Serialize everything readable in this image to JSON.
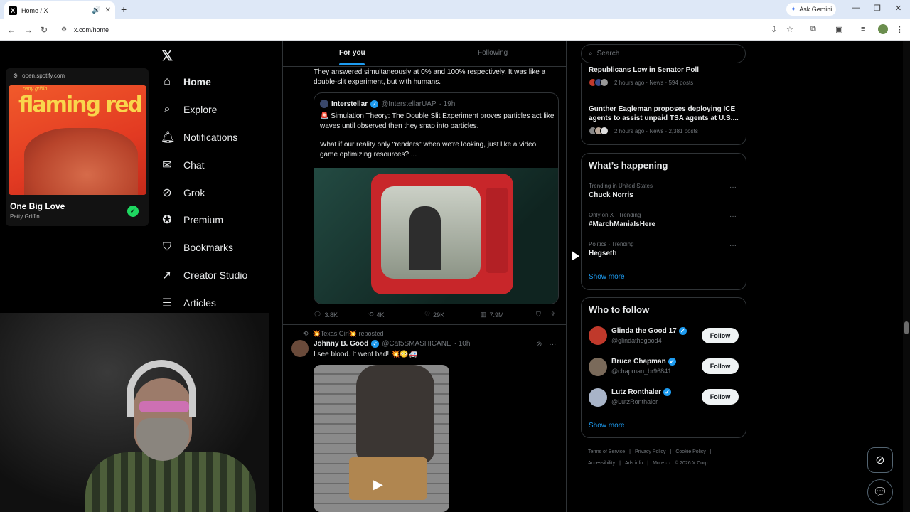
{
  "browser": {
    "tab_title": "Home / X",
    "tab_favicon": "X",
    "url": "x.com/home",
    "gemini_label": "Ask Gemini"
  },
  "spotify": {
    "url": "open.spotify.com",
    "album_small": "patty griffin",
    "album_title": "flaming red",
    "song": "One Big Love",
    "artist": "Patty Griffin"
  },
  "nav": {
    "items": [
      {
        "label": "Home",
        "icon": "home-icon"
      },
      {
        "label": "Explore",
        "icon": "search-icon"
      },
      {
        "label": "Notifications",
        "icon": "bell-icon"
      },
      {
        "label": "Chat",
        "icon": "mail-icon"
      },
      {
        "label": "Grok",
        "icon": "grok-icon"
      },
      {
        "label": "Premium",
        "icon": "premium-icon"
      },
      {
        "label": "Bookmarks",
        "icon": "bookmark-icon"
      },
      {
        "label": "Creator Studio",
        "icon": "rocket-icon"
      },
      {
        "label": "Articles",
        "icon": "article-icon"
      }
    ]
  },
  "feed": {
    "tabs": [
      "For you",
      "Following"
    ],
    "post1": {
      "text": "They answered simultaneously at 0% and 100% respectively. It was like a double-slit experiment, but with humans.",
      "quote": {
        "name": "Interstellar",
        "handle": "@InterstellarUAP",
        "time": "· 19h",
        "line1": "🚨 Simulation Theory: The Double Slit Experiment proves particles act like waves until observed then they snap into particles.",
        "line2": "What if our reality only \"renders\" when we're looking, just like a video game optimizing resources? ..."
      },
      "replies": "3.8K",
      "reposts": "4K",
      "likes": "29K",
      "views": "7.9M"
    },
    "post2": {
      "reposted_by": "💥Texas Girl💥 reposted",
      "name": "Johnny B. Good",
      "handle": "@Cat5SMASHICANE",
      "time": "· 10h",
      "text": "I see blood. It went bad! 💥😳🚑"
    }
  },
  "sidebar": {
    "search_placeholder": "Search",
    "news": [
      {
        "title": "Republicans Low in Senator Poll",
        "meta": "2 hours ago · News · 594 posts"
      },
      {
        "title": "Gunther Eagleman proposes deploying ICE agents to assist unpaid TSA agents at U.S....",
        "meta": "2 hours ago · News · 2,381 posts"
      }
    ],
    "happening_title": "What’s happening",
    "trends": [
      {
        "context": "Trending in United States",
        "name": "Chuck Norris"
      },
      {
        "context": "Only on X · Trending",
        "name": "#MarchManiaIsHere"
      },
      {
        "context": "Politics · Trending",
        "name": "Hegseth"
      }
    ],
    "show_more": "Show more",
    "wtf_title": "Who to follow",
    "who_to_follow": [
      {
        "name": "Glinda the Good 17",
        "handle": "@glindathegood4",
        "color": "#c0392b"
      },
      {
        "name": "Bruce Chapman",
        "handle": "@chapman_br96841",
        "color": "#7a6a5a"
      },
      {
        "name": "Lutz Ronthaler",
        "handle": "@LutzRonthaler",
        "color": "#a8b4c8"
      }
    ],
    "follow_label": "Follow",
    "footer": [
      "Terms of Service",
      "|",
      "Privacy Policy",
      "|",
      "Cookie Policy",
      "|",
      "Accessibility",
      "|",
      "Ads info",
      "|",
      "More ···",
      "© 2026 X Corp."
    ]
  }
}
